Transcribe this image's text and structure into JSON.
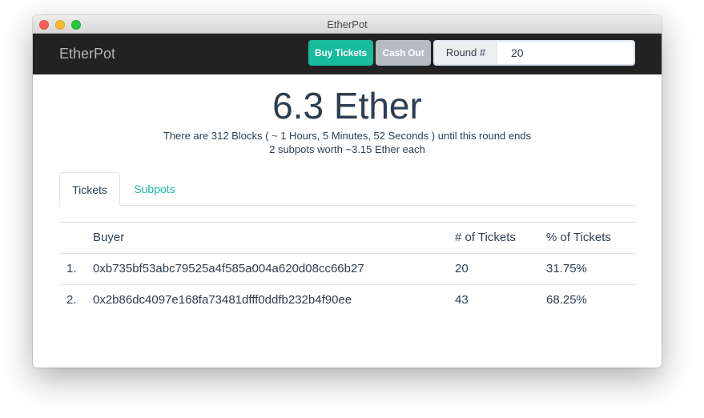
{
  "window": {
    "title": "EtherPot"
  },
  "navbar": {
    "brand": "EtherPot",
    "buy_label": "Buy Tickets",
    "cash_label": "Cash Out",
    "round_label": "Round #",
    "round_value": "20"
  },
  "pot": {
    "amount": "6.3 Ether",
    "blocks_text": "There are 312 Blocks ( ~ 1 Hours, 5 Minutes, 52 Seconds ) until this round ends",
    "subpots_text": "2 subpots worth ~3.15 Ether each"
  },
  "tabs": [
    {
      "label": "Tickets",
      "active": true
    },
    {
      "label": "Subpots",
      "active": false
    }
  ],
  "table": {
    "headers": {
      "num": "",
      "buyer": "Buyer",
      "count": "# of Tickets",
      "pct": "% of Tickets"
    },
    "rows": [
      {
        "num": "1.",
        "buyer": "0xb735bf53abc79525a4f585a004a620d08cc66b27",
        "count": "20",
        "pct": "31.75%"
      },
      {
        "num": "2.",
        "buyer": "0x2b86dc4097e168fa73481dfff0ddfb232b4f90ee",
        "count": "43",
        "pct": "68.25%"
      }
    ]
  },
  "colors": {
    "accent": "#18bc9c",
    "navbar": "#222222",
    "text": "#2c3e50",
    "muted_button": "#b4bcc2"
  }
}
